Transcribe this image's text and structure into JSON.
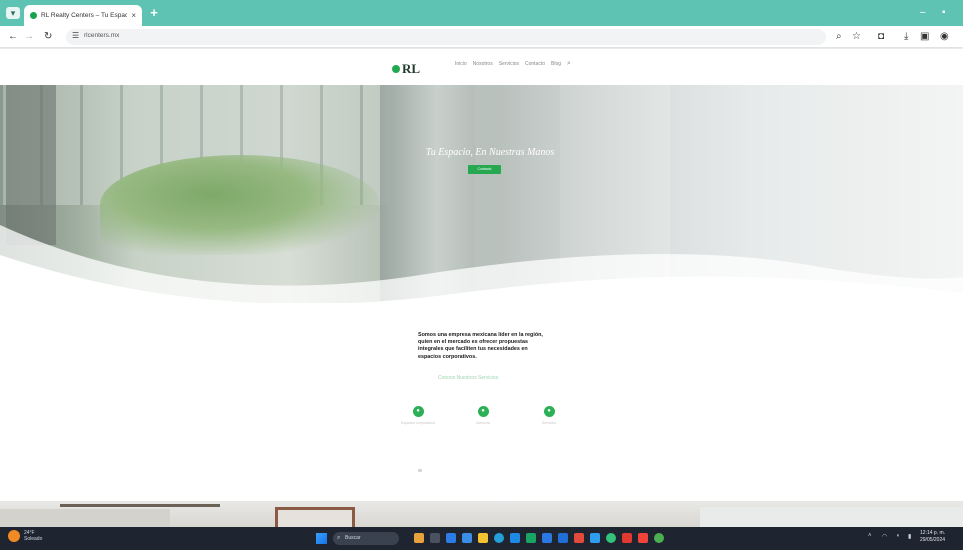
{
  "browser": {
    "tab_title": "RL Realty Centers – Tu Espacio",
    "tab_close": "×",
    "new_tab": "+",
    "url": "rlcenters.mx",
    "window_controls": [
      "–",
      "▪"
    ],
    "toolbar_icons": [
      "zoom-icon",
      "star-icon",
      "extensions-icon",
      "download-icon",
      "sidepanel-icon",
      "profile-icon"
    ]
  },
  "site": {
    "logo_text": "RL",
    "nav_items": [
      "Inicio",
      "Nosotros",
      "Servicios",
      "Contacto",
      "Blog"
    ],
    "nav_search": "⌕"
  },
  "hero": {
    "title": "Tu Espacio, En Nuestras Manos",
    "button": "Contacto"
  },
  "about": {
    "text": "Somos una empresa mexicana líder en la región, quien en el mercado es ofrecer propuestas integrales que faciliten tus necesidades en espacios corporativos.",
    "link": "Conoce Nuestros Servicios"
  },
  "features": [
    {
      "icon": "building-icon",
      "glyph": "●",
      "label": "Espacios corporativos"
    },
    {
      "icon": "handshake-icon",
      "glyph": "●",
      "label": "Asesoría"
    },
    {
      "icon": "check-icon",
      "glyph": "●",
      "label": "Servicios"
    }
  ],
  "taskbar": {
    "weather_temp": "24°F",
    "weather_desc": "Soleado",
    "search_placeholder": "Buscar",
    "time": "12:14 p. m.",
    "date": "29/05/2024"
  },
  "colors": {
    "accent_green": "#25a84f",
    "chrome_teal": "#5fc3b4",
    "taskbar": "#1f2530"
  }
}
